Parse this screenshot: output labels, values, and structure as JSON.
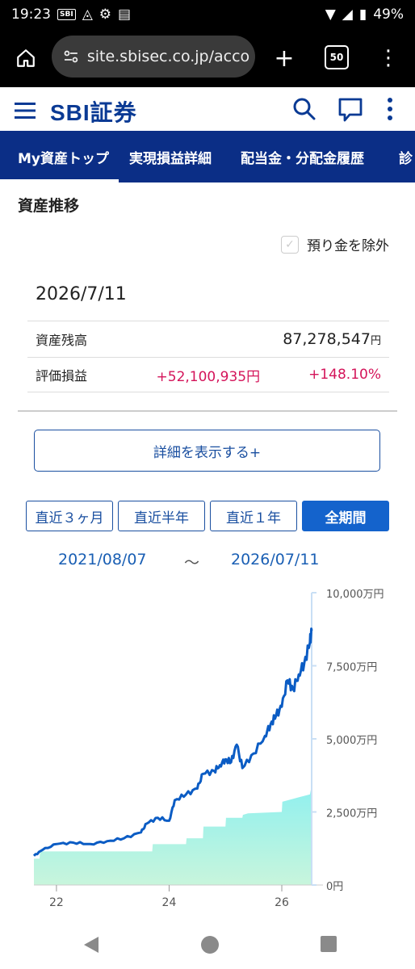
{
  "status": {
    "time": "19:23",
    "battery": "49%",
    "sbi_badge": "SBI"
  },
  "browser": {
    "url": "site.sbisec.co.jp/acco",
    "tab_count": "50"
  },
  "header": {
    "logo": "SBI証券"
  },
  "nav": {
    "tabs": [
      "My資産トップ",
      "実現損益詳細",
      "配当金・分配金履歴",
      "診"
    ]
  },
  "page": {
    "section_title": "資産推移",
    "exclude_deposit_label": "預り金を除外",
    "date": "2026/7/11",
    "balance_label": "資産残高",
    "balance_value": "87,278,547",
    "balance_unit": "円",
    "pl_label": "評価損益",
    "pl_value": "+52,100,935円",
    "pl_percent": "+148.10%",
    "detail_button": "詳細を表示する+",
    "periods": [
      "直近３ヶ月",
      "直近半年",
      "直近１年",
      "全期間"
    ],
    "active_period": "全期間",
    "range_start": "2021/08/07",
    "range_sep": "～",
    "range_end": "2026/07/11"
  },
  "chart_data": {
    "type": "area",
    "y_unit": "万円",
    "y_ticks": [
      "10,000万円",
      "7,500万円",
      "5,000万円",
      "2,500万円",
      "0円"
    ],
    "x_ticks": [
      "22",
      "24",
      "26"
    ],
    "ylim": [
      0,
      10000
    ],
    "colors": {
      "line": "#0b5cc4",
      "area_top": "#8ff0ef",
      "area_bottom": "#c8f5dc"
    },
    "series": [
      {
        "type": "line",
        "x": [
          2021.6,
          2021.75,
          2022.0,
          2022.3,
          2022.6,
          2022.9,
          2023.2,
          2023.5,
          2023.6,
          2023.8,
          2024.0,
          2024.1,
          2024.3,
          2024.5,
          2024.6,
          2024.8,
          2024.9,
          2025.0,
          2025.1,
          2025.2,
          2025.3,
          2025.5,
          2025.7,
          2025.8,
          2025.9,
          2026.0,
          2026.1,
          2026.2,
          2026.3,
          2026.4,
          2026.5,
          2026.53
        ],
        "y": [
          1000,
          1200,
          1400,
          1450,
          1400,
          1500,
          1600,
          1800,
          2100,
          2300,
          2200,
          2900,
          3100,
          3300,
          3800,
          3900,
          4100,
          4300,
          4200,
          4800,
          4000,
          4500,
          5100,
          5500,
          5800,
          6100,
          7000,
          6700,
          7200,
          7600,
          8300,
          8700
        ]
      },
      {
        "type": "area",
        "x": [
          2021.6,
          2021.7,
          2021.71,
          2022.0,
          2023.7,
          2023.71,
          2024.3,
          2024.31,
          2024.6,
          2024.61,
          2025.0,
          2025.01,
          2025.3,
          2025.31,
          2025.4,
          2026.0,
          2026.01,
          2026.3,
          2026.5,
          2026.53
        ],
        "y": [
          900,
          900,
          1150,
          1150,
          1150,
          1400,
          1400,
          1600,
          1600,
          2000,
          2000,
          2300,
          2300,
          2400,
          2450,
          2500,
          2850,
          3000,
          3100,
          3400
        ]
      }
    ]
  }
}
